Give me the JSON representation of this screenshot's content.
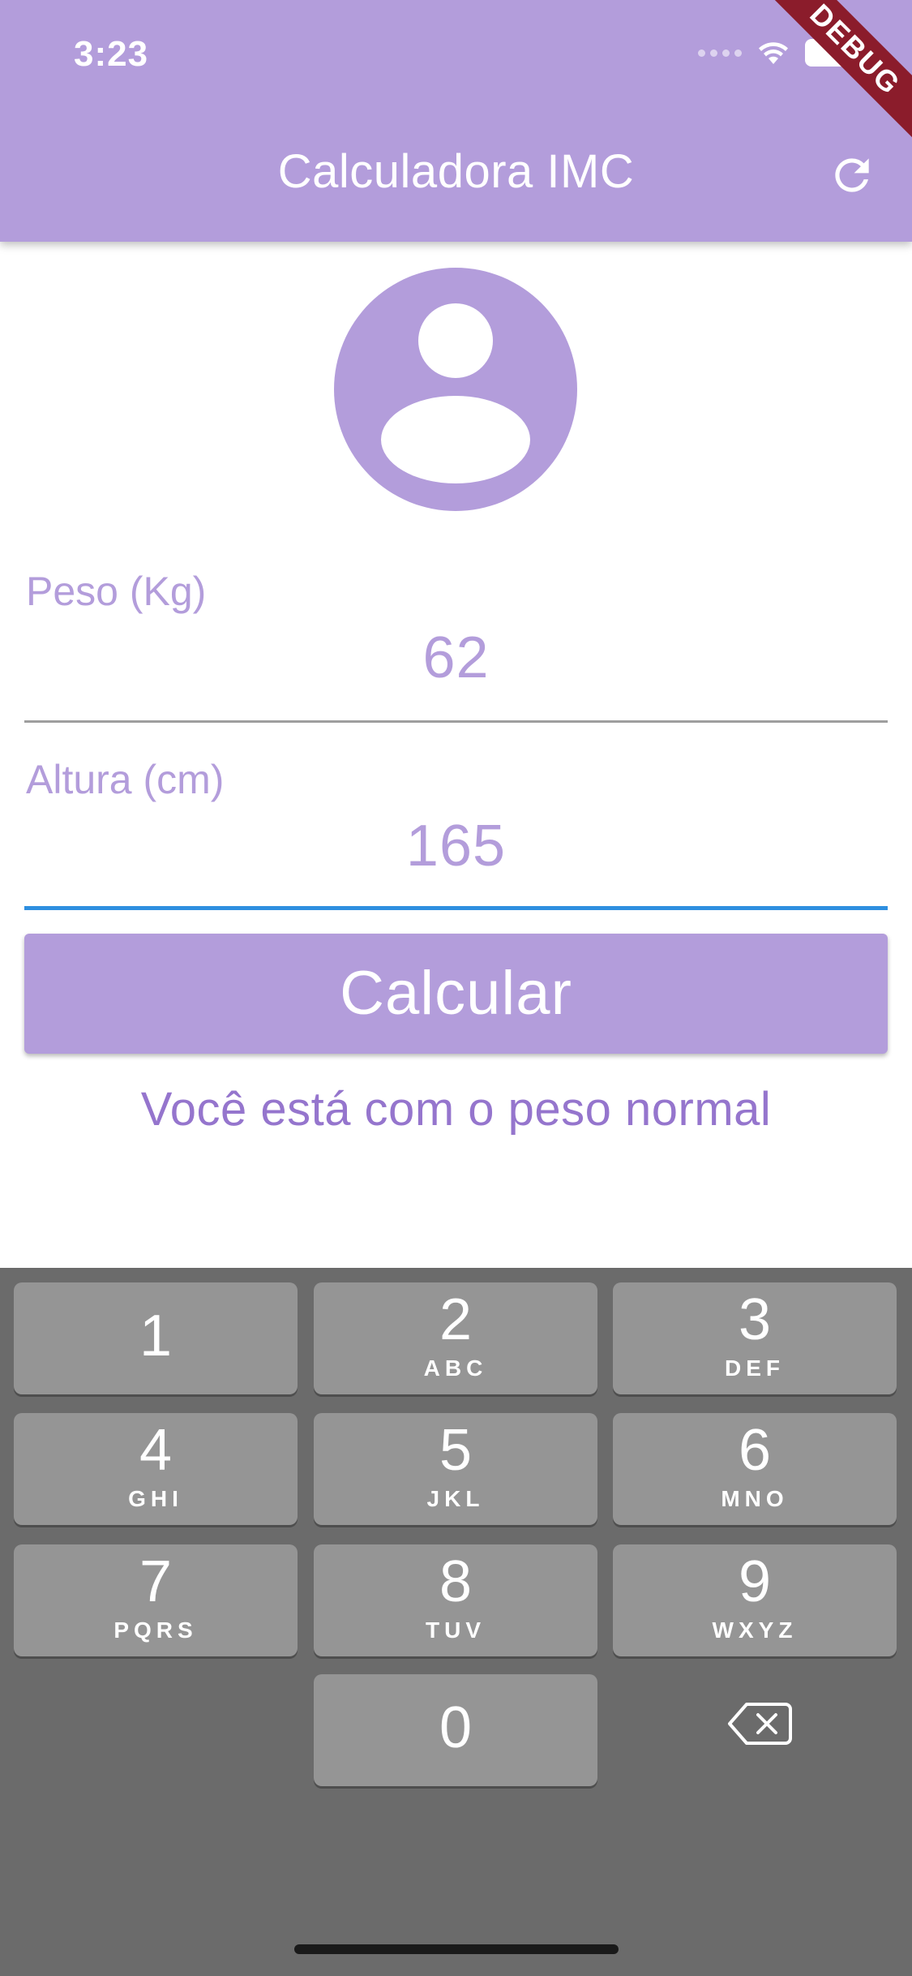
{
  "status_bar": {
    "time": "3:23"
  },
  "debug_banner": "DEBUG",
  "app_bar": {
    "title": "Calculadora IMC",
    "action_icon": "refresh-icon"
  },
  "avatar_icon": "account-circle-icon",
  "form": {
    "weight": {
      "label": "Peso (Kg)",
      "value": "62"
    },
    "height": {
      "label": "Altura (cm)",
      "value": "165"
    }
  },
  "calculate_button": {
    "label": "Calcular"
  },
  "result": {
    "text": "Você está com o peso normal"
  },
  "keyboard": {
    "keys": [
      {
        "digit": "1",
        "letters": ""
      },
      {
        "digit": "2",
        "letters": "ABC"
      },
      {
        "digit": "3",
        "letters": "DEF"
      },
      {
        "digit": "4",
        "letters": "GHI"
      },
      {
        "digit": "5",
        "letters": "JKL"
      },
      {
        "digit": "6",
        "letters": "MNO"
      },
      {
        "digit": "7",
        "letters": "PQRS"
      },
      {
        "digit": "8",
        "letters": "TUV"
      },
      {
        "digit": "9",
        "letters": "WXYZ"
      },
      {
        "digit": "0",
        "letters": ""
      }
    ],
    "delete_icon": "backspace-icon"
  },
  "colors": {
    "primary": "#b39ddb",
    "result_text": "#9575cd",
    "focus_underline": "#2e8fe0",
    "keyboard_bg": "#6b6b6b",
    "key_bg": "#959595"
  }
}
